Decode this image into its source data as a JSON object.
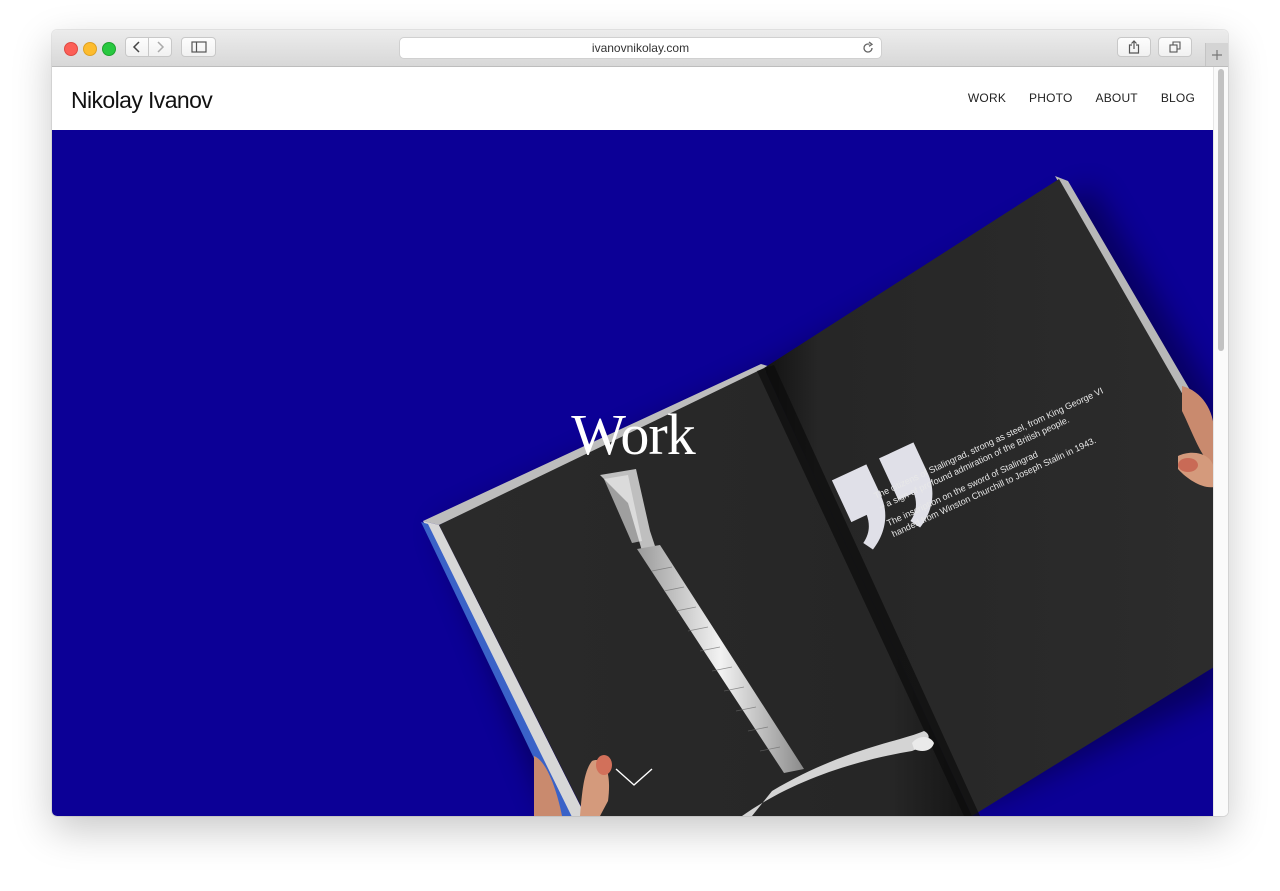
{
  "browser": {
    "url": "ivanovnikolay.com"
  },
  "site": {
    "logo": "Nikolay Ivanov",
    "nav": [
      {
        "label": "WORK"
      },
      {
        "label": "PHOTO"
      },
      {
        "label": "ABOUT"
      },
      {
        "label": "BLOG"
      }
    ]
  },
  "hero": {
    "title": "Work",
    "background": "#0c0096",
    "book": {
      "quote_mark": "”",
      "quote_line_1": "The citizens of Stalingrad, strong as steel, from King George VI",
      "quote_line_2": "– a sign of profound admiration of the British people.",
      "caption_line_1": "The inscription on the sword of Stalingrad",
      "caption_line_2": "handed from Winston Churchill to Joseph Stalin in 1943."
    }
  },
  "icons": {
    "back": "chevron-left-icon",
    "forward": "chevron-right-icon",
    "sidebar": "sidebar-icon",
    "reload": "reload-icon",
    "share": "share-icon",
    "tabs": "tabs-overview-icon",
    "new_tab": "plus-icon",
    "scroll_down": "chevron-down-icon"
  }
}
